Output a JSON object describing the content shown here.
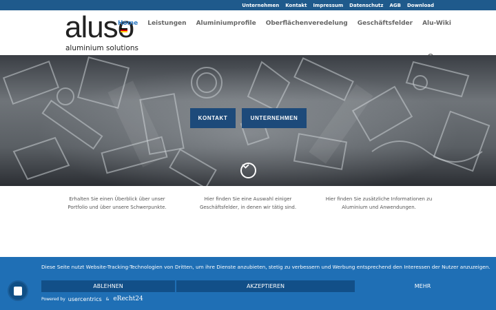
{
  "topbar": {
    "links": [
      "Unternehmen",
      "Kontakt",
      "Impressum",
      "Datenschutz",
      "AGB",
      "Download"
    ]
  },
  "logo": {
    "word": "aluso",
    "sub": "aluminium solutions"
  },
  "nav": {
    "items": [
      "Home",
      "Leistungen",
      "Aluminiumprofile",
      "Oberflächenveredelung",
      "Geschäftsfelder",
      "Alu-Wiki"
    ],
    "active": "Home"
  },
  "hero": {
    "buttons": [
      "KONTAKT",
      "UNTERNEHMEN"
    ]
  },
  "teasers": [
    "Erhalten Sie einen Überblick über unser Portfolio und über unsere Schwerpunkte.",
    "Hier finden Sie eine Auswahl einiger Geschäftsfelder, in denen wir tätig sind.",
    "Hier finden Sie zusätzliche Informationen zu Aluminium und Anwendungen."
  ],
  "cookie": {
    "text": "Diese Seite nutzt Website-Tracking-Technologien von Dritten, um ihre Dienste anzubieten, stetig zu verbessern und Werbung entsprechend den Interessen der Nutzer anzuzeigen.",
    "decline": "ABLEHNEN",
    "accept": "AKZEPTIEREN",
    "more": "MEHR",
    "powered_by": "Powered by",
    "usercentrics": "usercentrics",
    "amp": "&",
    "erecht": "eRecht24"
  },
  "colors": {
    "topbar": "#1f5a8c",
    "nav_active": "#2e7ac3",
    "cookie_bg": "#1f6fb5",
    "button_dark": "#1d4a7a"
  },
  "icons": [
    "flag-de-icon",
    "search-icon",
    "chevron-down-icon",
    "fingerprint-icon"
  ]
}
